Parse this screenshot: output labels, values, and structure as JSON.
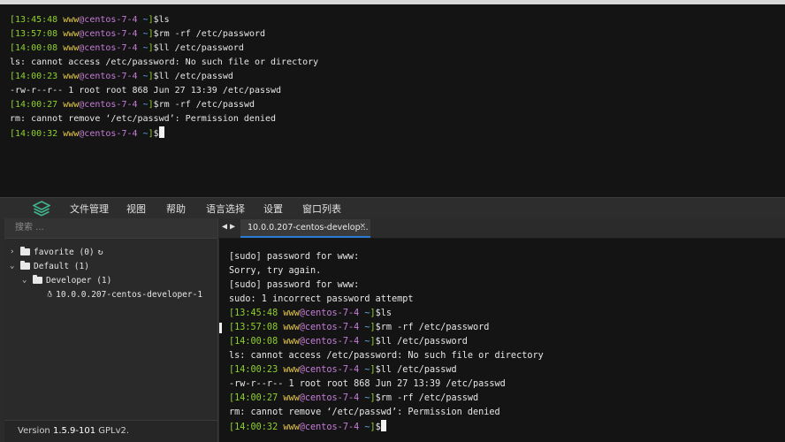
{
  "top_terminal": {
    "lines": [
      {
        "type": "prompt",
        "time": "13:45:48",
        "user": "www",
        "host": "centos-7-4",
        "cwd": "~",
        "cmd": "ls"
      },
      {
        "type": "prompt",
        "time": "13:57:08",
        "user": "www",
        "host": "centos-7-4",
        "cwd": "~",
        "cmd": "rm -rf /etc/password"
      },
      {
        "type": "prompt",
        "time": "14:00:08",
        "user": "www",
        "host": "centos-7-4",
        "cwd": "~",
        "cmd": "ll /etc/password"
      },
      {
        "type": "output",
        "text": "ls: cannot access /etc/password: No such file or directory"
      },
      {
        "type": "prompt",
        "time": "14:00:23",
        "user": "www",
        "host": "centos-7-4",
        "cwd": "~",
        "cmd": "ll /etc/passwd"
      },
      {
        "type": "output",
        "text": "-rw-r--r-- 1 root root 868 Jun 27 13:39 /etc/passwd"
      },
      {
        "type": "prompt",
        "time": "14:00:27",
        "user": "www",
        "host": "centos-7-4",
        "cwd": "~",
        "cmd": "rm -rf /etc/passwd"
      },
      {
        "type": "output",
        "text": "rm: cannot remove ‘/etc/passwd’: Permission denied"
      },
      {
        "type": "prompt",
        "time": "14:00:32",
        "user": "www",
        "host": "centos-7-4",
        "cwd": "~",
        "cmd": "",
        "cursor": true
      }
    ]
  },
  "menu": {
    "logo_icon": "layers-logo-icon",
    "items": [
      "文件管理",
      "视图",
      "帮助",
      "语言选择",
      "设置",
      "窗口列表"
    ]
  },
  "sidebar": {
    "search_placeholder": "搜索 ...",
    "tree": [
      {
        "label": "favorite (0)",
        "chevron": "›",
        "icon": "folder-icon",
        "refresh": "↻"
      },
      {
        "label": "Default (1)",
        "chevron": "⌄",
        "icon": "folder-icon"
      },
      {
        "label": "Developer (1)",
        "chevron": "⌄",
        "icon": "folder-open-icon"
      },
      {
        "label": "10.0.0.207-centos-developer-1",
        "icon": "linux-icon"
      }
    ],
    "version_prefix": "Version ",
    "version_number": "1.5.9-101",
    "version_suffix": " GPLv2."
  },
  "tabbar": {
    "prev": "◀",
    "next": "▶",
    "tab_label": "10.0.0.207-centos-develop...",
    "tab_close": "×"
  },
  "terminal": {
    "lines": [
      {
        "type": "output",
        "text": "[sudo] password for www:"
      },
      {
        "type": "output",
        "text": "Sorry, try again."
      },
      {
        "type": "output",
        "text": "[sudo] password for www:"
      },
      {
        "type": "output",
        "text": "sudo: 1 incorrect password attempt"
      },
      {
        "type": "prompt",
        "time": "13:45:48",
        "user": "www",
        "host": "centos-7-4",
        "cwd": "~",
        "cmd": "ls"
      },
      {
        "type": "prompt",
        "time": "13:57:08",
        "user": "www",
        "host": "centos-7-4",
        "cwd": "~",
        "cmd": "rm -rf /etc/password"
      },
      {
        "type": "prompt",
        "time": "14:00:08",
        "user": "www",
        "host": "centos-7-4",
        "cwd": "~",
        "cmd": "ll /etc/password"
      },
      {
        "type": "output",
        "text": "ls: cannot access /etc/password: No such file or directory"
      },
      {
        "type": "prompt",
        "time": "14:00:23",
        "user": "www",
        "host": "centos-7-4",
        "cwd": "~",
        "cmd": "ll /etc/passwd"
      },
      {
        "type": "output",
        "text": "-rw-r--r-- 1 root root 868 Jun 27 13:39 /etc/passwd"
      },
      {
        "type": "prompt",
        "time": "14:00:27",
        "user": "www",
        "host": "centos-7-4",
        "cwd": "~",
        "cmd": "rm -rf /etc/passwd"
      },
      {
        "type": "output",
        "text": "rm: cannot remove ‘/etc/passwd’: Permission denied"
      },
      {
        "type": "prompt",
        "time": "14:00:32",
        "user": "www",
        "host": "centos-7-4",
        "cwd": "~",
        "cmd": "",
        "cursor": true
      }
    ]
  },
  "colors": {
    "prompt_bracket": "#8fd12d",
    "prompt_user": "#e6c84a",
    "prompt_host": "#c77dd9",
    "prompt_cwd": "#5fa8e6",
    "tab_active_underline": "#2a7bd4",
    "logo": "#3fb68b"
  }
}
